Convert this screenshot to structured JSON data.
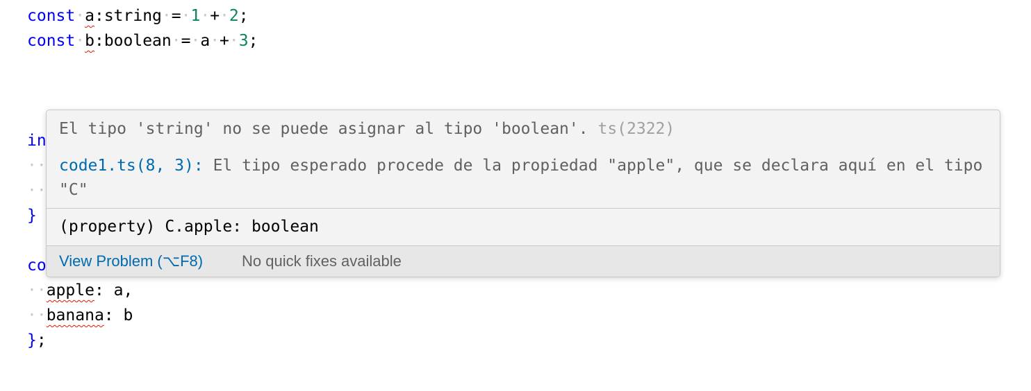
{
  "code": {
    "line1": {
      "keyword": "const",
      "var": "a",
      "type": ":string",
      "op1": "=",
      "num1": "1",
      "op2": "+",
      "num2": "2",
      "end": ";"
    },
    "line2": {
      "keyword": "const",
      "var": "b",
      "type": ":boolean",
      "op1": "=",
      "ref": "a",
      "op2": "+",
      "num": "3",
      "end": ";"
    },
    "line_in": "in",
    "line_brace": "}",
    "line_co": "co",
    "line_apple": {
      "key": "apple",
      "rest": ": a,"
    },
    "line_banana": {
      "key": "banana",
      "rest": ": b"
    },
    "line_end": {
      "brace": "}",
      "semi": ";"
    }
  },
  "hover": {
    "message": "El tipo 'string' no se puede asignar al tipo 'boolean'.",
    "code": "ts(2322)",
    "related_link": "code1.ts(8, 3):",
    "related_text": "El tipo esperado procede de la propiedad \"apple\", que se declara aquí en el tipo \"C\"",
    "type_info": "(property) C.apple: boolean",
    "view_problem": "View Problem (⌥F8)",
    "no_fixes": "No quick fixes available"
  },
  "colors": {
    "keyword": "#0000ff",
    "number": "#098658",
    "link": "#006ab1",
    "error_squiggle": "#e51400",
    "hover_bg": "#f3f3f3",
    "status_bg": "#e7e7e7"
  }
}
